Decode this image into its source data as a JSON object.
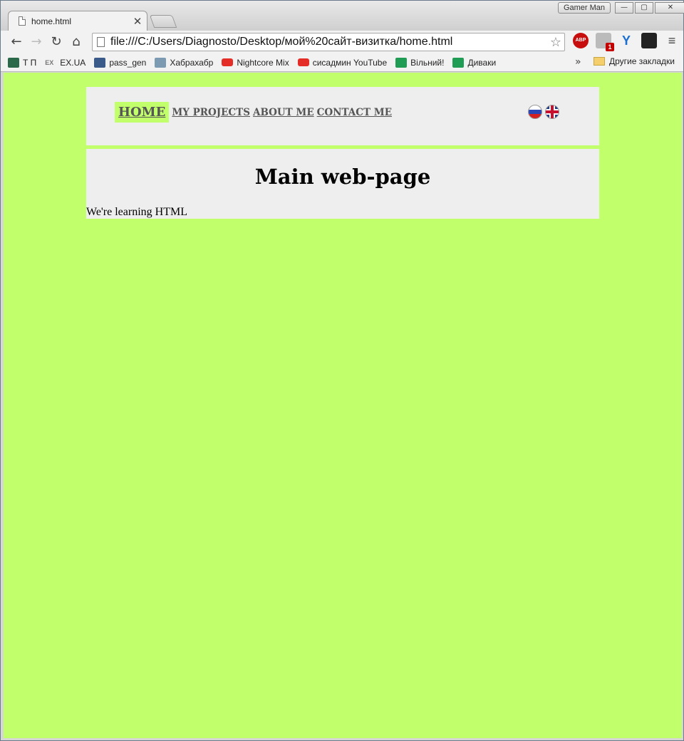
{
  "window": {
    "tab_title": "home.html",
    "tab_close": "✕",
    "profile_name": "Gamer Man",
    "min_glyph": "—",
    "max_glyph": "▢",
    "close_glyph": "✕"
  },
  "toolbar": {
    "back_icon": "←",
    "forward_icon": "→",
    "reload_icon": "↻",
    "home_icon": "⌂",
    "url": "file:///C:/Users/Diagnosto/Desktop/мой%20сайт-визитка/home.html",
    "star_icon": "☆",
    "extensions": {
      "abp_label": "ABP",
      "shield_badge": "1",
      "vpn_glyph": "Y",
      "menu_glyph": "≡"
    }
  },
  "bookmarks": {
    "items": [
      {
        "label": "Т П",
        "icon": "tp"
      },
      {
        "label": "EX.UA",
        "icon": "ex",
        "icon_text": "EX"
      },
      {
        "label": "pass_gen",
        "icon": "pass"
      },
      {
        "label": "Хабрахабр",
        "icon": "habr"
      },
      {
        "label": "Nightcore Mix",
        "icon": "youtube"
      },
      {
        "label": "сисадмин YouTube",
        "icon": "youtube"
      },
      {
        "label": "Вільний!",
        "icon": "sheet"
      },
      {
        "label": "Диваки",
        "icon": "sheet"
      }
    ],
    "more": "»",
    "other_folder": "Другие закладки"
  },
  "page": {
    "background": "#c1ff6b",
    "panel_color": "#eeeeee",
    "nav": {
      "home": "HOME",
      "projects": "MY PROJECTS",
      "about": "ABOUT ME",
      "contact": "CONTACT ME"
    },
    "flags": [
      "russia-flag",
      "uk-flag"
    ],
    "heading": "Main web-page",
    "paragraph": "We're learning HTML"
  }
}
